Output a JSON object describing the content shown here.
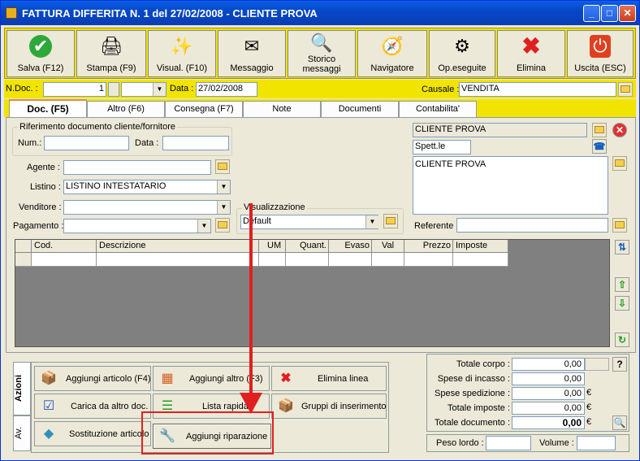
{
  "window": {
    "title": "FATTURA DIFFERITA N. 1  del 27/02/2008 - CLIENTE PROVA",
    "minimize": "_",
    "maximize": "□",
    "close": "✕"
  },
  "toolbar": {
    "save": "Salva (F12)",
    "print": "Stampa (F9)",
    "view": "Visual. (F10)",
    "message": "Messaggio",
    "history_line1": "Storico",
    "history_line2": "messaggi",
    "navigator": "Navigatore",
    "operations": "Op.eseguite",
    "delete": "Elimina",
    "exit": "Uscita (ESC)"
  },
  "header": {
    "ndoc_label": "N.Doc. :",
    "ndoc_value": "1",
    "data_label": "Data :",
    "data_value": "27/02/2008",
    "causale_label": "Causale :",
    "causale_value": "VENDITA"
  },
  "tabs": [
    "Doc. (F5)",
    "Altro (F6)",
    "Consegna (F7)",
    "Note",
    "Documenti",
    "Contabilita'"
  ],
  "doc": {
    "rif_title": "Riferimento documento cliente/fornitore",
    "num_label": "Num.:",
    "data_label": "Data :",
    "agente_label": "Agente :",
    "listino_label": "Listino :",
    "listino_value": "LISTINO INTESTATARIO",
    "venditore_label": "Venditore :",
    "pagamento_label": "Pagamento :",
    "visualizzazione_title": "Visualizzazione",
    "visualizzazione_value": "Default",
    "client_name": "CLIENTE PROVA",
    "client_salutation": "Spett.le",
    "client_address": "CLIENTE PROVA",
    "referente_label": "Referente"
  },
  "grid": {
    "columns": [
      "Cod.",
      "Descrizione",
      "UM",
      "Quant.",
      "Evaso",
      "Val",
      "Prezzo",
      "Imposte"
    ]
  },
  "actions": {
    "tab_azioni": "Azioni",
    "tab_av": "Av.",
    "add_article": "Aggiungi articolo (F4)",
    "add_other": "Aggiungi altro (F3)",
    "delete_line": "Elimina linea",
    "load_from_doc": "Carica da altro doc.",
    "quick_list": "Lista rapida",
    "insert_groups": "Gruppi di inserimento",
    "replace_article": "Sostituzione articolo",
    "add_repair": "Aggiungi riparazione"
  },
  "totals": {
    "corpo_label": "Totale corpo :",
    "corpo_value": "0,00",
    "incasso_label": "Spese di incasso :",
    "incasso_value": "0,00",
    "spedizione_label": "Spese spedizione :",
    "spedizione_value": "0,00",
    "imposte_label": "Totale imposte :",
    "imposte_value": "0,00",
    "documento_label": "Totale documento :",
    "documento_value": "0,00",
    "currency": "€",
    "help": "?",
    "peso_label": "Peso lordo :",
    "volume_label": "Volume :"
  }
}
